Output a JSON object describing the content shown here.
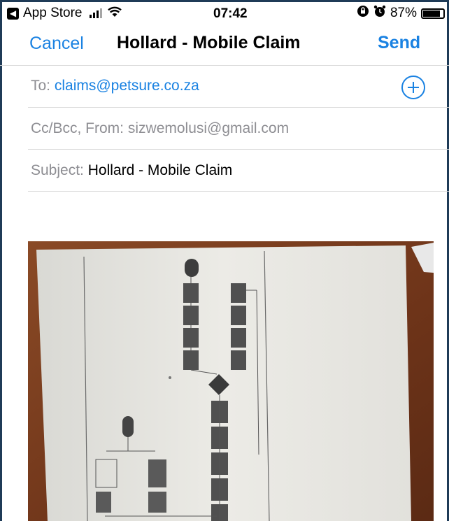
{
  "status_bar": {
    "back_app": "App Store",
    "time": "07:42",
    "battery_percent": "87%",
    "battery_level": 0.87,
    "icons": [
      "back-arrow-icon",
      "cellular-signal-icon",
      "wifi-icon",
      "orientation-lock-icon",
      "alarm-icon",
      "battery-icon"
    ]
  },
  "nav": {
    "cancel_label": "Cancel",
    "title": "Hollard - Mobile Claim",
    "send_label": "Send",
    "accent_color": "#1a82e2"
  },
  "compose": {
    "to_label": "To:",
    "to_value": "claims@petsure.co.za",
    "cc_label": "Cc/Bcc, From:",
    "from_value": "sizwemolusi@gmail.com",
    "subject_label": "Subject:",
    "subject_value": "Hollard - Mobile Claim",
    "add_recipient_icon": "plus-circle-icon"
  },
  "attachment": {
    "type": "photo",
    "description_icon": "photo-of-printed-flowchart"
  }
}
